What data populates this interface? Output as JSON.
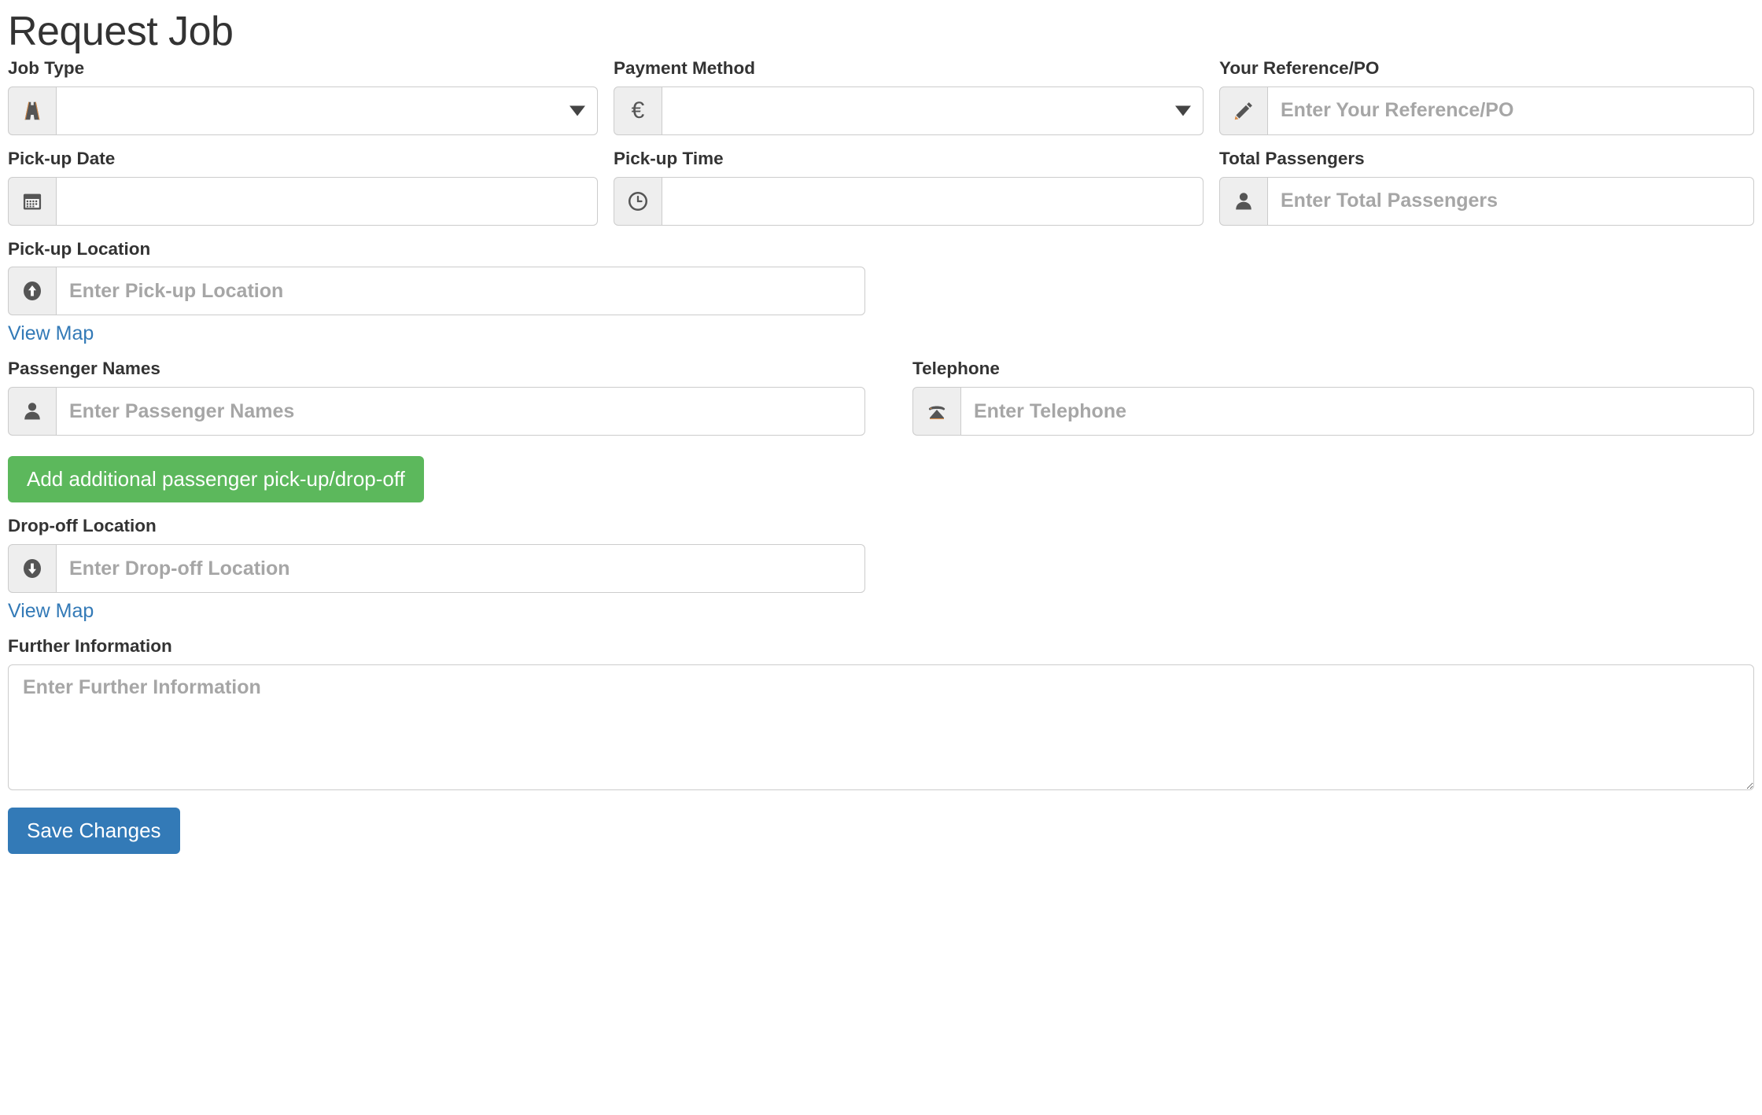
{
  "page": {
    "title": "Request Job"
  },
  "fields": {
    "job_type": {
      "label": "Job Type",
      "icon": "road-icon",
      "value": "",
      "options": [
        ""
      ],
      "type": "select"
    },
    "payment_method": {
      "label": "Payment Method",
      "icon": "euro-icon",
      "icon_glyph": "€",
      "value": "",
      "options": [
        ""
      ],
      "type": "select"
    },
    "reference_po": {
      "label": "Your Reference/PO",
      "icon": "pencil-icon",
      "placeholder": "Enter Your Reference/PO",
      "value": ""
    },
    "pickup_date": {
      "label": "Pick-up Date",
      "icon": "calendar-icon",
      "placeholder": "",
      "value": ""
    },
    "pickup_time": {
      "label": "Pick-up Time",
      "icon": "clock-icon",
      "placeholder": "",
      "value": ""
    },
    "total_passengers": {
      "label": "Total Passengers",
      "icon": "user-icon",
      "placeholder": "Enter Total Passengers",
      "value": ""
    },
    "pickup_location": {
      "label": "Pick-up Location",
      "icon": "arrow-up-circle-icon",
      "placeholder": "Enter Pick-up Location",
      "value": "",
      "map_link": "View Map"
    },
    "passenger_names": {
      "label": "Passenger Names",
      "icon": "user-icon",
      "placeholder": "Enter Passenger Names",
      "value": ""
    },
    "telephone": {
      "label": "Telephone",
      "icon": "phone-icon",
      "placeholder": "Enter Telephone",
      "value": ""
    },
    "dropoff_location": {
      "label": "Drop-off Location",
      "icon": "arrow-down-circle-icon",
      "placeholder": "Enter Drop-off Location",
      "value": "",
      "map_link": "View Map"
    },
    "further_information": {
      "label": "Further Information",
      "placeholder": "Enter Further Information",
      "value": ""
    }
  },
  "buttons": {
    "add_passenger": "Add additional passenger pick-up/drop-off",
    "save_changes": "Save Changes"
  },
  "colors": {
    "green": "#5cb85c",
    "blue": "#337ab7",
    "link": "#337ab7",
    "addon_bg": "#eeeeee",
    "border": "#cccccc",
    "placeholder": "#a6a6a6",
    "text": "#333333"
  }
}
